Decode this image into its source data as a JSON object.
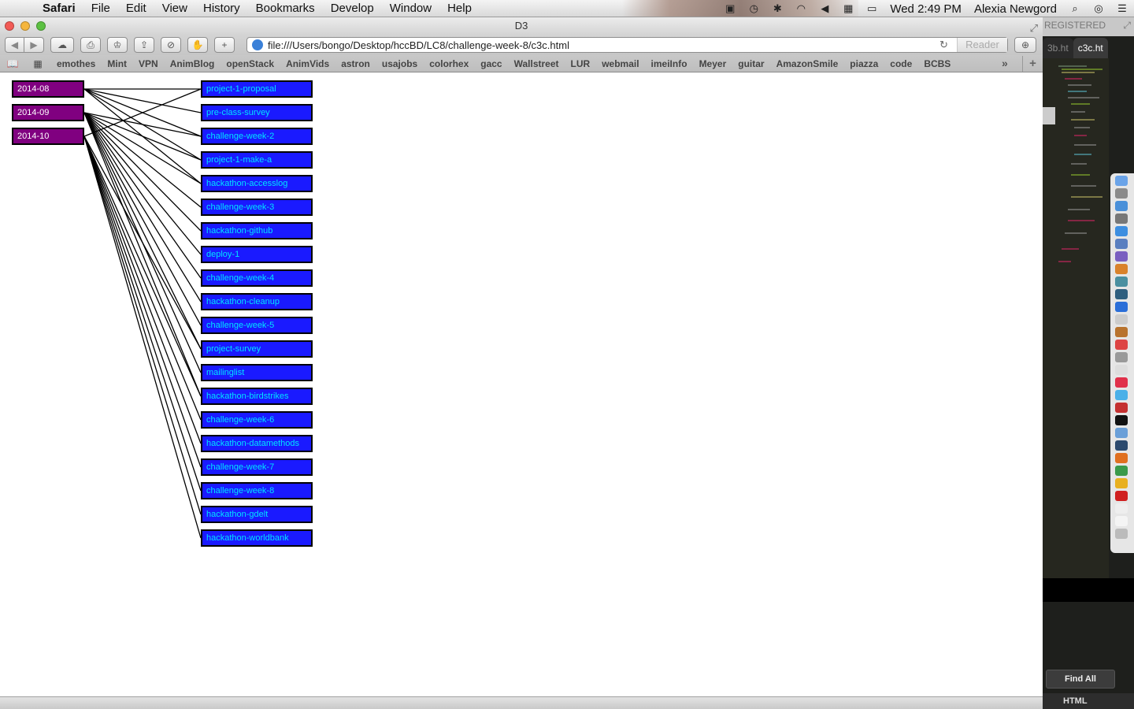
{
  "menubar": {
    "apple": "",
    "items": [
      "Safari",
      "File",
      "Edit",
      "View",
      "History",
      "Bookmarks",
      "Develop",
      "Window",
      "Help"
    ],
    "clock": "Wed 2:49 PM",
    "user": "Alexia Newgord"
  },
  "window": {
    "title": "D3",
    "url": "file:///Users/bongo/Desktop/hccBD/LC8/challenge-week-8/c3c.html",
    "reader_label": "Reader"
  },
  "bookmarks": [
    "emothes",
    "Mint",
    "VPN",
    "AnimBlog",
    "openStack",
    "AnimVids",
    "astron",
    "usajobs",
    "colorhex",
    "gacc",
    "Wallstreet",
    "LUR",
    "webmail",
    "imeiInfo",
    "Meyer",
    "guitar",
    "AmazonSmile",
    "piazza",
    "code",
    "BCBS"
  ],
  "graph": {
    "months": [
      "2014-08",
      "2014-09",
      "2014-10"
    ],
    "items": [
      "project-1-proposal",
      "pre-class-survey",
      "challenge-week-2",
      "project-1-make-a",
      "hackathon-accesslog",
      "challenge-week-3",
      "hackathon-github",
      "deploy-1",
      "challenge-week-4",
      "hackathon-cleanup",
      "challenge-week-5",
      "project-survey",
      "mailinglist",
      "hackathon-birdstrikes",
      "challenge-week-6",
      "hackathon-datamethods",
      "challenge-week-7",
      "challenge-week-8",
      "hackathon-gdelt",
      "hackathon-worldbank"
    ],
    "links": [
      {
        "month": 0,
        "items": [
          0,
          1,
          2,
          3,
          4
        ]
      },
      {
        "month": 1,
        "items": [
          2,
          3,
          4,
          5,
          6,
          7,
          8,
          9,
          10,
          11,
          12,
          13
        ]
      },
      {
        "month": 2,
        "items": [
          0,
          11,
          13,
          14,
          15,
          16,
          17,
          18,
          19
        ]
      }
    ],
    "colors": {
      "month_fill": "#800080",
      "month_text": "#ffffff",
      "item_fill": "#1a1aff",
      "item_text": "#00e5ff",
      "link": "#000000"
    }
  },
  "sidepanel": {
    "registered": "REGISTERED",
    "tabs": [
      "3b.ht",
      "c3c.ht"
    ],
    "find_all": "Find All",
    "syntax": "HTML"
  }
}
